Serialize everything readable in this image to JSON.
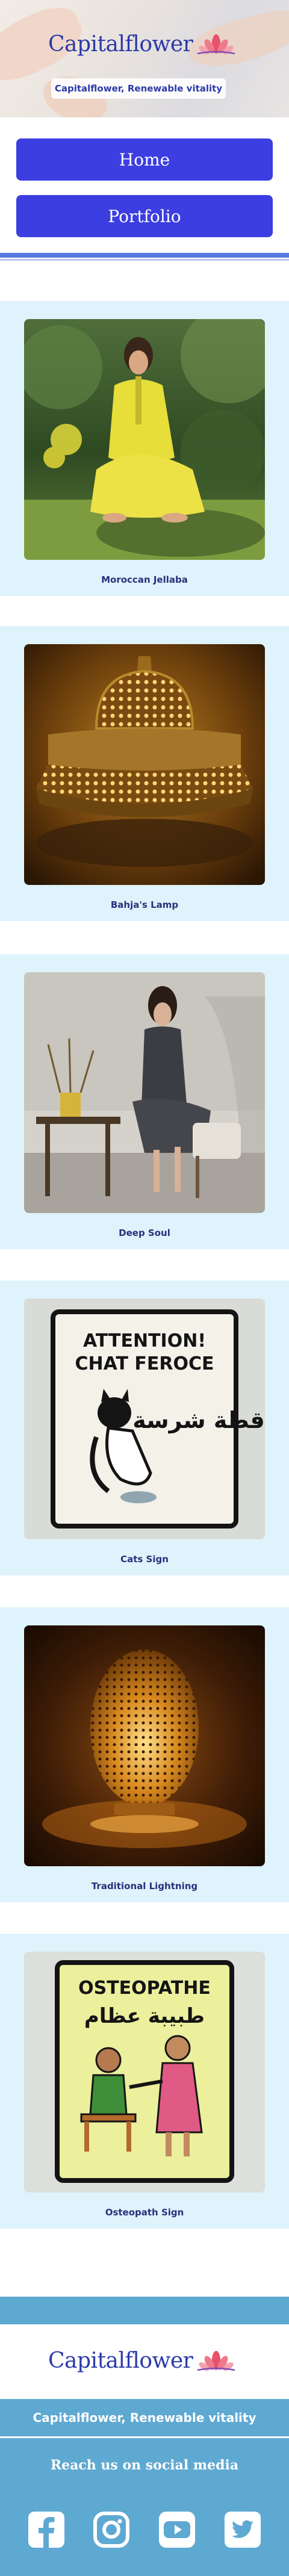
{
  "brand": {
    "name": "Capitalflower",
    "tagline": "Capitalflower, Renewable vitality",
    "colors": {
      "primary": "#3c3ee2",
      "navy": "#27317a",
      "sky": "#5ea9d2",
      "card_bg": "#dff3fc",
      "lotus": "#e8516a"
    }
  },
  "nav": {
    "home": "Home",
    "portfolio": "Portfolio"
  },
  "portfolio": {
    "items": [
      {
        "title": "Moroccan Jellaba",
        "image": "woman-yellow-jellaba-photo"
      },
      {
        "title": "Bahja's Lamp",
        "image": "brass-lamp-photo"
      },
      {
        "title": "Deep Soul",
        "image": "woman-seated-dark-dress-photo"
      },
      {
        "title": "Cats Sign",
        "image": "cat-sign-photo",
        "sign_lines": [
          "ATTENTION!",
          "CHAT FEROCE"
        ],
        "sign_arabic": "قطة شرسة"
      },
      {
        "title": "Traditional Lightning",
        "image": "egg-lantern-photo"
      },
      {
        "title": "Osteopath Sign",
        "image": "osteopath-sign-photo",
        "sign_line": "OSTEOPATHE",
        "sign_arabic": "طبيبة عظام"
      }
    ]
  },
  "footer": {
    "logo_name": "Capitalflower",
    "tagline": "Capitalflower, Renewable vitality",
    "social_title": "Reach us on social media",
    "social": [
      {
        "name": "facebook",
        "icon": "facebook-icon"
      },
      {
        "name": "instagram",
        "icon": "instagram-icon"
      },
      {
        "name": "youtube",
        "icon": "youtube-icon"
      },
      {
        "name": "twitter",
        "icon": "twitter-icon"
      }
    ]
  }
}
